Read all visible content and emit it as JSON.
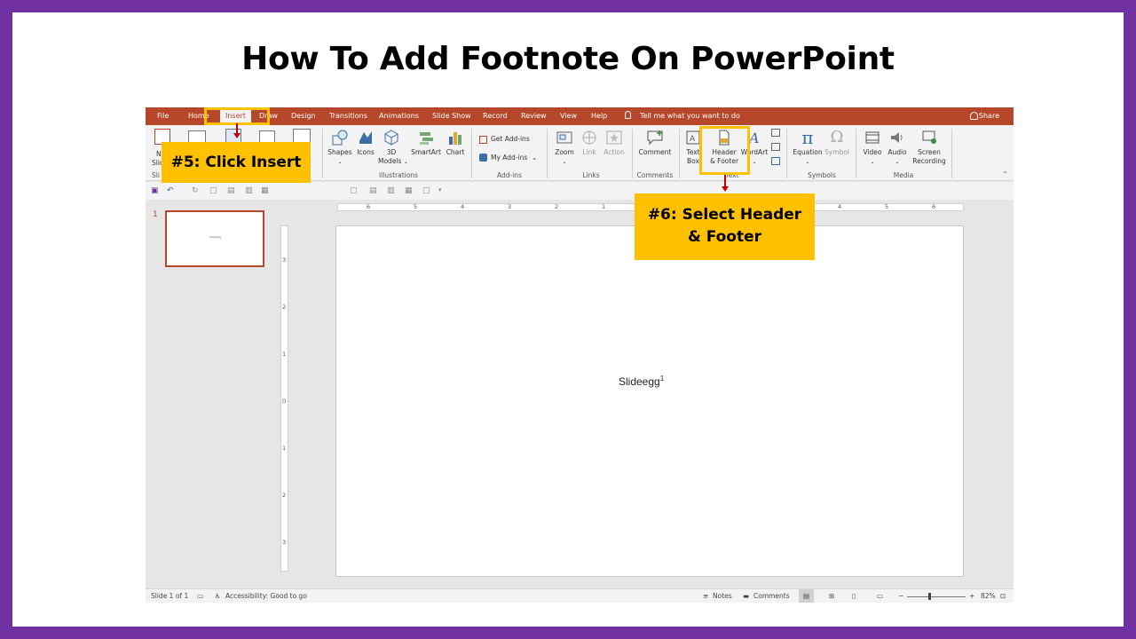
{
  "slide_title": "How To Add Footnote On PowerPoint",
  "tabs": {
    "file": "File",
    "home": "Home",
    "insert": "Insert",
    "draw": "Draw",
    "design": "Design",
    "transitions": "Transitions",
    "animations": "Animations",
    "slideshow": "Slide Show",
    "record": "Record",
    "review": "Review",
    "view": "View",
    "help": "Help",
    "tell_me": "Tell me what you want to do",
    "share": "Share"
  },
  "ribbon": {
    "new_slide_1": "N",
    "new_slide_2": "Slic",
    "slides_group": "Sli",
    "shapes": "Shapes",
    "icons": "Icons",
    "models_1": "3D",
    "models_2": "Models",
    "smartart": "SmartArt",
    "chart": "Chart",
    "illustrations_group": "Illustrations",
    "get_addins": "Get Add-ins",
    "my_addins": "My Add-ins",
    "addins_group": "Add-ins",
    "zoom": "Zoom",
    "link": "Link",
    "action": "Action",
    "links_group": "Links",
    "comment": "Comment",
    "comments_group": "Comments",
    "textbox_1": "Text",
    "textbox_2": "Box",
    "header_footer_1": "Header",
    "header_footer_2": "& Footer",
    "wordart": "WordArt",
    "text_group": "Text",
    "equation": "Equation",
    "symbol": "Symbol",
    "symbols_group": "Symbols",
    "video": "Video",
    "audio": "Audio",
    "screen_rec_1": "Screen",
    "screen_rec_2": "Recording",
    "media_group": "Media"
  },
  "thumbnail": {
    "number": "1",
    "text": "Slideegg"
  },
  "canvas": {
    "text": "Slideegg",
    "footnote_mark": "1"
  },
  "ruler": {
    "h": [
      "6",
      "5",
      "4",
      "3",
      "2",
      "1",
      "4",
      "5",
      "6"
    ],
    "v": [
      "3",
      "2",
      "1",
      "0",
      "1",
      "2",
      "3"
    ]
  },
  "status": {
    "slide_count": "Slide 1 of 1",
    "accessibility": "Accessibility: Good to go",
    "notes": "Notes",
    "comments": "Comments",
    "zoom": "82%"
  },
  "callouts": {
    "step5": "#5: Click Insert",
    "step6_line1": "#6: Select Header",
    "step6_line2": "& Footer"
  },
  "colors": {
    "accent": "#b7472a",
    "highlight": "#ffc000",
    "frame": "#7030a0",
    "arrow": "#c00000"
  }
}
